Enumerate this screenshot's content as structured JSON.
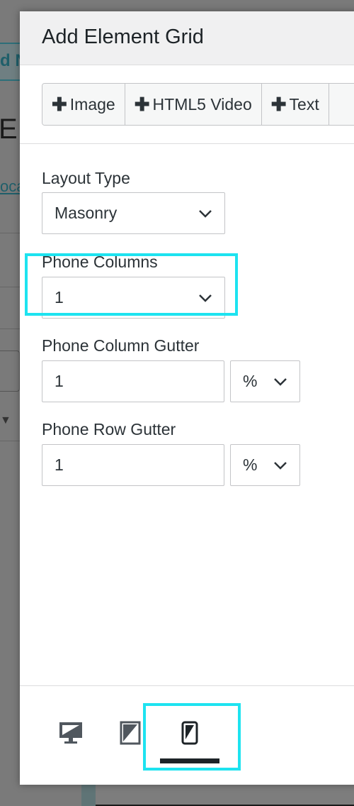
{
  "background": {
    "button_text": "d N",
    "heading_letter": "E",
    "link_text": "oca"
  },
  "modal": {
    "title": "Add Element Grid",
    "toolbar": {
      "buttons": [
        {
          "label": "Image"
        },
        {
          "label": "HTML5 Video"
        },
        {
          "label": "Text"
        }
      ]
    },
    "fields": {
      "layout_type": {
        "label": "Layout Type",
        "value": "Masonry"
      },
      "phone_columns": {
        "label": "Phone Columns",
        "value": "1"
      },
      "phone_column_gutter": {
        "label": "Phone Column Gutter",
        "value": "1",
        "unit": "%"
      },
      "phone_row_gutter": {
        "label": "Phone Row Gutter",
        "value": "1",
        "unit": "%"
      }
    },
    "devices": {
      "active": "phone",
      "items": [
        "desktop",
        "tablet",
        "phone"
      ]
    },
    "colors": {
      "highlight": "#1de3f0",
      "text": "#2c3338",
      "border": "#c3c4c7"
    }
  }
}
